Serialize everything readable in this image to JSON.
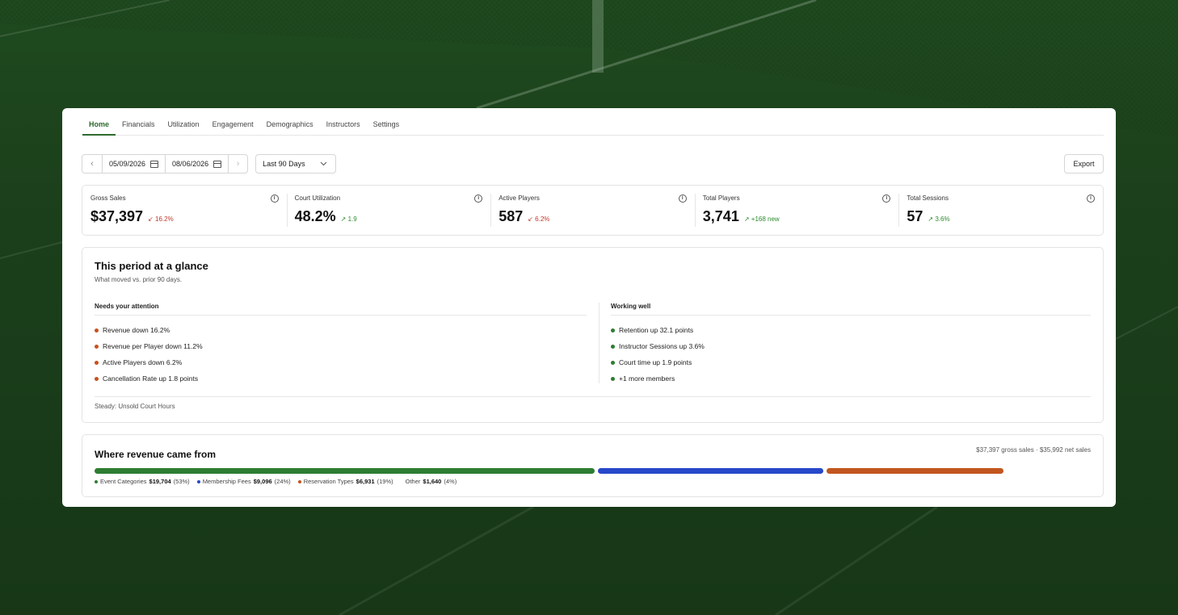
{
  "colors": {
    "accent": "#2e6b2e",
    "negative": "#c0392b",
    "positive": "#2e8b2e",
    "event_categories": "#2e7d32",
    "membership_fees": "#2748c9",
    "reservation_types": "#c2561f",
    "other": "#9e9e9e"
  },
  "tabs": [
    "Home",
    "Financials",
    "Utilization",
    "Engagement",
    "Demographics",
    "Instructors",
    "Settings"
  ],
  "active_tab": "Home",
  "datebar": {
    "prev_icon": "chevron-left-icon",
    "start_date": "05/09/2026",
    "end_date": "08/06/2026",
    "next_icon": "chevron-right-icon",
    "range_label": "Last 90 Days",
    "export_label": "Export"
  },
  "metrics": [
    {
      "label": "Gross Sales",
      "value": "$37,397",
      "delta": "16.2%",
      "direction": "down"
    },
    {
      "label": "Court Utilization",
      "value": "48.2%",
      "delta": "1.9",
      "direction": "up"
    },
    {
      "label": "Active Players",
      "value": "587",
      "delta": "6.2%",
      "direction": "down"
    },
    {
      "label": "Total Players",
      "value": "3,741",
      "delta": "+168 new",
      "direction": "up"
    },
    {
      "label": "Total Sessions",
      "value": "57",
      "delta": "3.6%",
      "direction": "up"
    }
  ],
  "glance": {
    "title": "This period at a glance",
    "subtitle": "What moved vs. prior 90 days.",
    "attention_heading": "Needs your attention",
    "attention_items": [
      "Revenue down 16.2%",
      "Revenue per Player down 11.2%",
      "Active Players down 6.2%",
      "Cancellation Rate up 1.8 points"
    ],
    "working_heading": "Working well",
    "working_items": [
      "Retention up 32.1 points",
      "Instructor Sessions up 3.6%",
      "Court time up 1.9 points",
      "+1 more members"
    ],
    "steady": "Steady: Unsold Court Hours"
  },
  "revenue": {
    "title": "Where revenue came from",
    "summary": "$37,397 gross sales · $35,992 net sales",
    "segments": [
      {
        "name": "Event Categories",
        "amount": "$19,704",
        "pct": "(53%)",
        "share": 0.53
      },
      {
        "name": "Membership Fees",
        "amount": "$9,096",
        "pct": "(24%)",
        "share": 0.24
      },
      {
        "name": "Reservation Types",
        "amount": "$6,931",
        "pct": "(19%)",
        "share": 0.19
      },
      {
        "name": "Other",
        "amount": "$1,640",
        "pct": "(4%)",
        "share": 0.04
      }
    ]
  }
}
